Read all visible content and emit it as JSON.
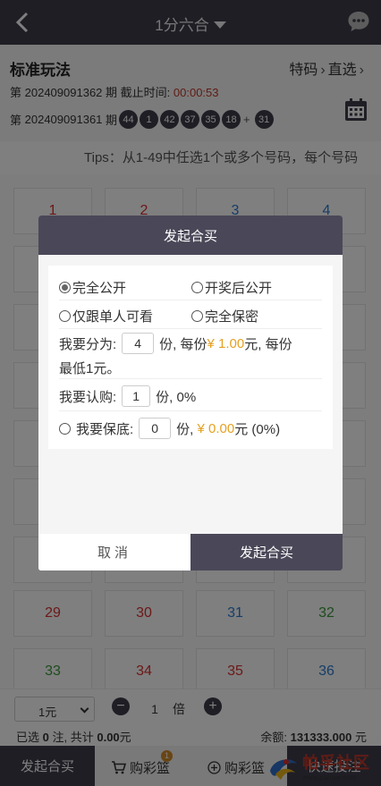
{
  "topbar": {
    "title": "1分六合"
  },
  "info": {
    "play_title": "标准玩法",
    "link_special": "特码",
    "link_direct": "直选",
    "current_prefix": "第",
    "current_period": "202409091362",
    "current_suffix": "期 截止时间:",
    "countdown": "00:00:53",
    "last_prefix": "第",
    "last_period": "202409091361",
    "last_suffix": "期",
    "balls": [
      "44",
      "1",
      "42",
      "37",
      "35",
      "18"
    ],
    "special_ball": "31",
    "plus": "+"
  },
  "tips": "Tips：从1-49中任选1个或多个号码，每个号码",
  "grid": {
    "rows": [
      [
        {
          "n": "1",
          "c": "red"
        },
        {
          "n": "2",
          "c": "red"
        },
        {
          "n": "3",
          "c": "blue"
        },
        {
          "n": "4",
          "c": "blue"
        }
      ],
      [
        {
          "n": "29",
          "c": "red"
        },
        {
          "n": "30",
          "c": "red"
        },
        {
          "n": "31",
          "c": "blue"
        },
        {
          "n": "32",
          "c": "green"
        }
      ],
      [
        {
          "n": "33",
          "c": "green"
        },
        {
          "n": "34",
          "c": "red"
        },
        {
          "n": "35",
          "c": "red"
        },
        {
          "n": "36",
          "c": "blue"
        }
      ]
    ]
  },
  "controls": {
    "unit": "1元",
    "minus": "−",
    "multiplier": "1",
    "multiplier_unit": "倍",
    "plus": "+",
    "sel_prefix": "已选",
    "sel_count": "0",
    "sel_mid": "注, 共计",
    "sel_amount": "0.00",
    "sel_unit": "元",
    "balance_label": "余额:",
    "balance": "131333.000",
    "balance_unit": "元"
  },
  "bottom_nav": {
    "start": "发起合买",
    "cart": "购彩篮",
    "cart_badge": "1",
    "add_cart": "购彩篮",
    "quick": "快速投注"
  },
  "watermark": {
    "title": "帕孚社区",
    "url": "www.pahuai.com"
  },
  "dialog": {
    "title": "发起合买",
    "options": [
      {
        "label": "完全公开",
        "checked": true
      },
      {
        "label": "开奖后公开",
        "checked": false
      },
      {
        "label": "仅跟单人可看",
        "checked": false
      },
      {
        "label": "完全保密",
        "checked": false
      }
    ],
    "split_label": "我要分为:",
    "split_value": "4",
    "split_unit": "份,",
    "per_label": "每份",
    "per_amount": "¥ 1.00",
    "per_unit": "元, 每份",
    "min_line": "最低1元。",
    "buy_label": "我要认购:",
    "buy_value": "1",
    "buy_unit": "份, 0%",
    "guarantee_label": "我要保底:",
    "guarantee_value": "0",
    "guarantee_unit": "份,",
    "guarantee_amount": "¥ 0.00",
    "guarantee_suffix": "元 (0%)",
    "cancel": "取消",
    "confirm": "发起合买"
  }
}
